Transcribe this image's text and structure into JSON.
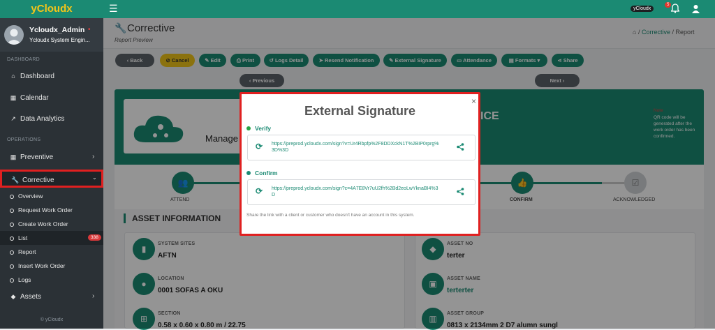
{
  "sidebar": {
    "brand": "yCloudx",
    "user_name": "Ycloudx_Admin",
    "user_role": "Ycloudx System Engin...",
    "section_dashboard": "DASHBOARD",
    "dashboard": "Dashboard",
    "calendar": "Calendar",
    "data_analytics": "Data Analytics",
    "section_operations": "OPERATIONS",
    "preventive": "Preventive",
    "corrective": "Corrective",
    "corrective_items": [
      "Overview",
      "Request Work Order",
      "Create Work Order",
      "List",
      "Report",
      "Insert Work Order",
      "Logs"
    ],
    "list_badge": "338",
    "assets": "Assets",
    "footer": "© yCloudx"
  },
  "topbar": {
    "account_chip": "yCloudx",
    "notification_count": "5"
  },
  "header": {
    "title": "Corrective",
    "subtitle": "Report Preview",
    "breadcrumb_link": "Corrective",
    "breadcrumb_sep": "/",
    "breadcrumb_current": "Report"
  },
  "toolbar": {
    "back": "Back",
    "cancel": "Cancel",
    "edit": "Edit",
    "print": "Print",
    "logs_detail": "Logs Detail",
    "resend_notification": "Resend Notification",
    "external_signature": "External Signature",
    "attendance": "Attendance",
    "formats": "Formats",
    "share": "Share",
    "previous": "Previous",
    "next": "Next"
  },
  "report": {
    "manage_text": "Manage",
    "title_partial": "ICE",
    "note_label": "Note",
    "note_text": "QR code will be generated after the work order has been confirmed.",
    "steps": [
      "ATTEND",
      "CONFIRM",
      "ACKNOWLEDGED"
    ],
    "asset_info_title": "ASSET INFORMATION",
    "system_sites_label": "SYSTEM SITES",
    "system_sites_value": "AFTN",
    "location_label": "LOCATION",
    "location_value": "0001 SOFAS A OKU",
    "section_label": "SECTION",
    "section_value": "0.58 x 0.60 x 0.80 m / 22.75",
    "asset_no_label": "ASSET NO",
    "asset_no_value": "terter",
    "asset_name_label": "ASSET NAME",
    "asset_name_value": "terterter",
    "asset_group_label": "ASSET GROUP",
    "asset_group_value": "0813 x 2134mm 2 D7 alumn sungl"
  },
  "modal": {
    "title": "External Signature",
    "close": "×",
    "verify_label": "Verify",
    "verify_link": "https://preprod.ycloudx.com/sign?v=Ur4Rbpfp%2F8DDXckN1T%2BIP0rprg%3D%3D",
    "confirm_label": "Confirm",
    "confirm_link": "https://preprod.ycloudx.com/sign?c=4A7E8Vr7uU2fh%2Bd2eoLwYknaBI4%3D",
    "note": "Share the link with a client or customer who doesn't have an account in this system."
  },
  "colors": {
    "brand_green": "#1b8a73",
    "sidebar_bg": "#2b3136",
    "highlight_red": "#e02020",
    "cancel_yellow": "#f0c419"
  }
}
